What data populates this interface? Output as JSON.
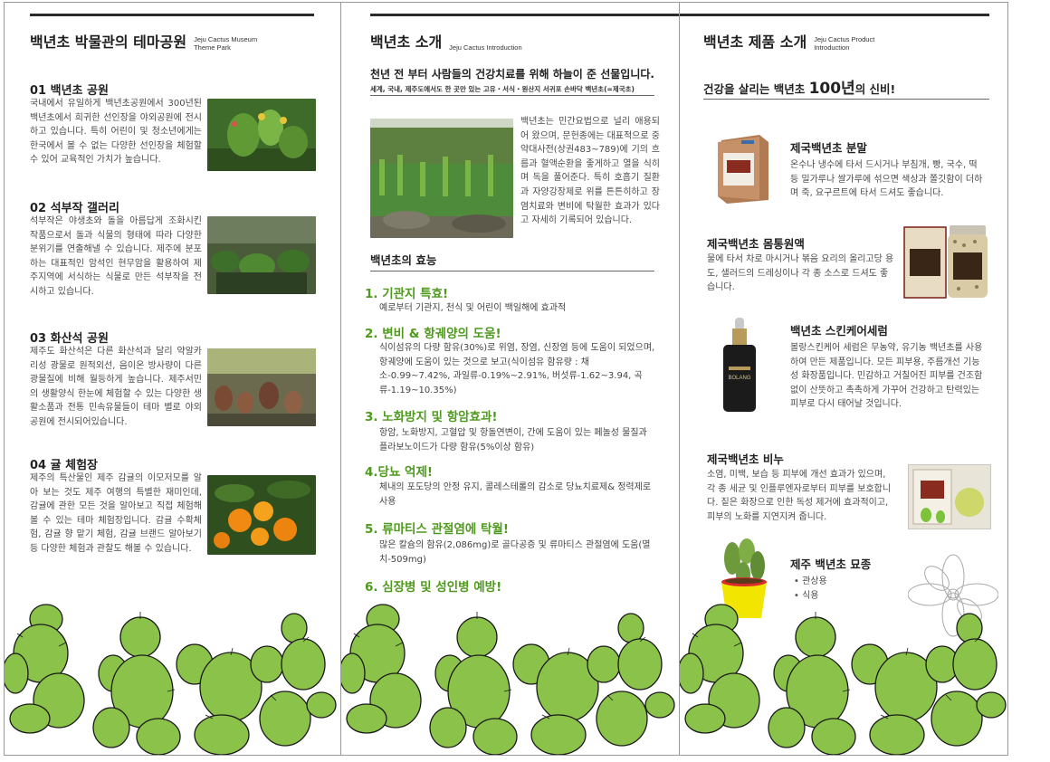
{
  "col1": {
    "title": "백년초 박물관의 테마공원",
    "subtitle": "Jeju Cactus Museum Theme Park",
    "sections": [
      {
        "heading": "01 백년초 공원",
        "body": "국내에서 유일하게 백년초공원에서 300년된 백년초에서 희귀한 선인장을 야외공원에 전시하고 있습니다. 특히 어린이 및 청소년에게는 한국에서 볼 수 없는 다양한 선인장을 체험할 수 있어 교육적인 가치가 높습니다."
      },
      {
        "heading": "02 석부작 갤러리",
        "body": "석부작은 야생초와 돌을 아름답게 조화시킨 작품으로서 돌과 식물의 형태에 따라 다양한 분위기를 연출해낼 수 있습니다. 제주에 분포하는 대표적인 암석인 현무암을 활용하여 제주지역에 서식하는 식물로 만든 석부작을 전시하고 있습니다."
      },
      {
        "heading": "03 화산석 공원",
        "body": "제주도 화산석은 다른 화산석과 달리 약알카리성 광물로 원적외선, 음이온 방사량이 다른 광물질에 비해 월등하게 높습니다. 제주서민의 생활양식 한눈에 체험할 수 있는 다양한 생활소품과 전통 민속유물들이 테마 별로 야외공원에 전시되어있습니다."
      },
      {
        "heading": "04 귤 체험장",
        "body": "제주의 특산물인 제주 감귤의 이모저모를 알아 보는 것도 제주 여행의 특별한 재미인데, 감귤에 관한 모든 것을 알아보고 직접 체험해 볼 수 있는 테마 체험장입니다. 감귤 수확체험, 감귤 향 맡기 체험, 감귤 브랜드 알아보기 등 다양한 체험과 관찰도 해볼 수 있습니다."
      }
    ]
  },
  "col2": {
    "title": "백년초 소개",
    "subtitle": "Jeju Cactus Introduction",
    "headline": "천년 전 부터 사람들의 건강치료를 위해 하늘이 준 선물입니다.",
    "subline": "세계, 국내, 제주도에서도 한 곳만 있는 고유・서식・원산지 서귀포 손바닥 백년초(=제국초)",
    "intro": "백년초는 민간요법으로 널리 애용되어 왔으며, 문헌종에는 대표적으로 중약대사전(상권483~789)에 기의 흐름과 혈액순환을 좋게하고 열을 식히며 독을 풀어준다. 특히 호흡기 질환과 자양강장제로 위를 튼튼히하고 장염치료와 변비에 탁월한 효과가 있다고 자세히 기록되어 있습니다.",
    "benefits_title": "백년초의 효능",
    "benefits": [
      {
        "heading": "1. 기관지 특효!",
        "body": "예로부터 기관지, 천식 및 어린이 백일해에 효과적"
      },
      {
        "heading": "2. 변비 & 항궤양의 도움!",
        "body": "식이섬유의 다량 함유(30%)로 위염, 장염, 신장염 등에 도움이 되었으며, 항궤양에 도움이 있는 것으로 보고(식이섬유 함유량 : 채소-0.99~7.42%, 과일류-0.19%~2.91%, 버섯류-1.62~3.94, 곡류-1.19~10.35%)"
      },
      {
        "heading": "3. 노화방지 및 항암효과!",
        "body": "항암, 노화방지, 고혈압 및 항돌연변이, 간에 도움이 있는 페놀성 물질과 플라보노이드가 다량 함유(5%이상 함유)"
      },
      {
        "heading": "4.당뇨 억제!",
        "body": "체내의 포도당의 안정 유지, 콜레스테롤의 감소로 당뇨치료제& 정력제로 사용"
      },
      {
        "heading": "5. 류마티스 관절염에 탁월!",
        "body": "많은 칼슘의 함유(2,086mg)로 골다공증 및 류마티스 관절염에 도움(멸치-509mg)"
      },
      {
        "heading": "6. 심장병 및 성인병 예방!",
        "body": ""
      }
    ]
  },
  "col3": {
    "title": "백년초 제품 소개",
    "subtitle": "Jeju Cactus Product Introduction",
    "headline_pre": "건강을 살리는 백년초 ",
    "headline_big": "100년",
    "headline_post": "의 신비!",
    "products": [
      {
        "name": "제국백년초 분말",
        "desc": "온수나 냉수에 타서 드시거나 부침개, 빵, 국수, 떡 등 밀가루나 쌀가루에 섞으면 색상과 쫄깃함이 더하며 죽, 요구르트에 타서 드셔도 좋습니다."
      },
      {
        "name": "제국백년초 몸통원액",
        "desc": "물에 타서 차로 마시거나 볶음 요리의 올리고당 용도, 샐러드의 드레싱이나 각 종 소스로 드셔도 좋습니다."
      },
      {
        "name": "백년초 스킨케어세럼",
        "desc": "볼랑스킨케어 세럼은 무농약, 유기농 백년초를 사용하여 만든 제품입니다. 모든 피부용, 주름개선 기능성 화장품입니다. 민감하고 거칠어진 피부를 건조함 없이 산뜻하고 촉촉하게 가꾸어 건강하고 탄력있는 피부로 다시 태어날 것입니다."
      },
      {
        "name": "제국백년초 비누",
        "desc": "소염, 미백, 보습 등 피부에 개선 효과가 있으며, 각 종 세균 및 인플루엔자로부터 피부를 보호합니다. 짙은 화장으로 인한 독성 제거에 효과적이고, 피부의 노화를 지연지켜 줍니다."
      },
      {
        "name": "제주 백년초 묘종",
        "desc": ""
      }
    ],
    "seedling_uses": [
      "• 관상용",
      "• 식용"
    ],
    "serum_label": "BOLANG"
  },
  "colors": {
    "accent_green": "#4f9a1e",
    "cactus_green": "#7cc23a",
    "rule": "#2b2b2b"
  }
}
